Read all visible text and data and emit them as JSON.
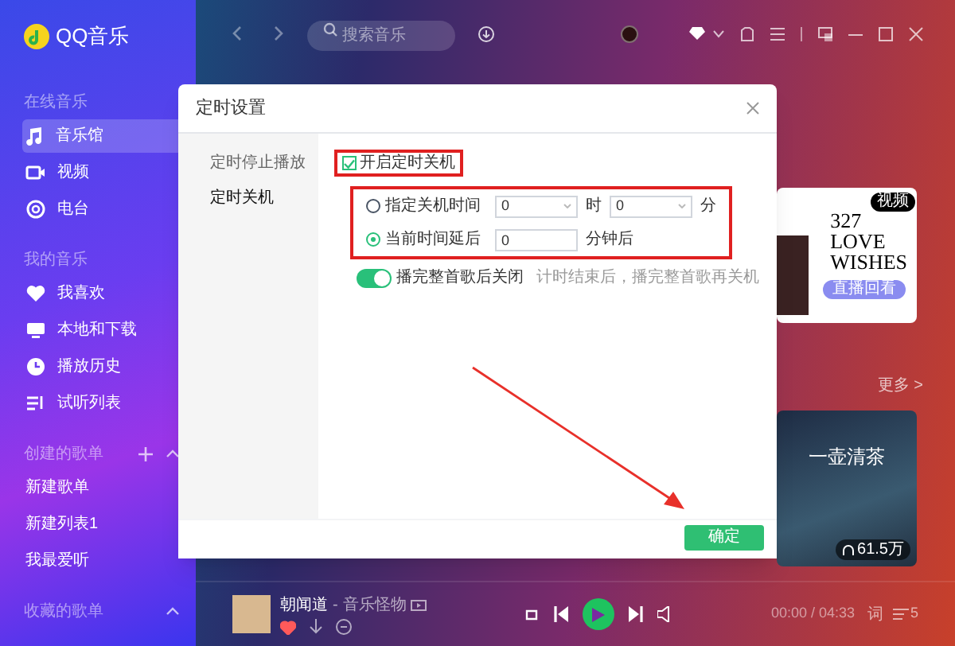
{
  "app": {
    "logo_text": "QQ音乐"
  },
  "sidebar": {
    "sections": [
      {
        "title": "在线音乐",
        "items": [
          {
            "label": "音乐馆",
            "selected": true
          },
          {
            "label": "视频",
            "selected": false
          },
          {
            "label": "电台",
            "selected": false
          }
        ]
      },
      {
        "title": "我的音乐",
        "items": [
          {
            "label": "我喜欢",
            "selected": false
          },
          {
            "label": "本地和下载",
            "selected": false
          },
          {
            "label": "播放历史",
            "selected": false
          },
          {
            "label": "试听列表",
            "selected": false
          }
        ]
      },
      {
        "title": "创建的歌单",
        "expanded": true,
        "items": [
          {
            "label": "新建歌单",
            "selected": false
          },
          {
            "label": "新建列表1",
            "selected": false
          },
          {
            "label": "我最爱听",
            "selected": false
          }
        ]
      },
      {
        "title": "收藏的歌单",
        "expanded": true
      }
    ]
  },
  "top_bar": {
    "search_placeholder": "搜索音乐"
  },
  "background": {
    "promo": {
      "badge": "视频",
      "number": "327",
      "title_lines": [
        "LOVE",
        "WISHES"
      ],
      "button": "直播回看"
    },
    "more_link": "更多 >",
    "playlist_card": {
      "title": "一壶清茶",
      "plays": "61.5万"
    }
  },
  "dialog": {
    "title": "定时设置",
    "tabs": [
      {
        "label": "定时停止播放",
        "selected": false
      },
      {
        "label": "定时关机",
        "selected": true
      }
    ],
    "enable_checkbox": {
      "label": "开启定时关机",
      "checked": true,
      "highlighted": true
    },
    "mode_group": {
      "highlighted": true,
      "options": [
        {
          "kind": "clock_time",
          "label": "指定关机时间",
          "selected": false,
          "hour": "0",
          "hour_unit": "时",
          "minute": "0",
          "minute_unit": "分"
        },
        {
          "kind": "delay",
          "label": "当前时间延后",
          "selected": true,
          "minutes": "0",
          "unit": "分钟后"
        }
      ]
    },
    "finish_song_toggle": {
      "label": "播完整首歌后关闭",
      "on": true,
      "hint": "计时结束后，播完整首歌再关机"
    },
    "confirm_button": "确定"
  },
  "annotation_arrow": true,
  "player": {
    "song": "朝闻道",
    "separator": "-",
    "artist": "音乐怪物",
    "liked": true,
    "time": "00:00 / 04:33",
    "lyrics_button": "词",
    "queue_count": "5"
  }
}
